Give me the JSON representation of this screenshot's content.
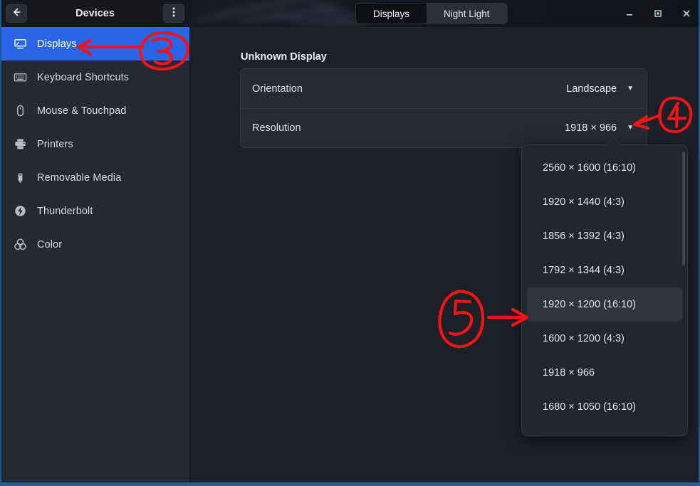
{
  "window": {
    "title": "Devices",
    "back_icon": "arrow-left-icon",
    "menu_icon": "kebab-menu-icon",
    "controls": {
      "minimize": "−",
      "maximize": "▫",
      "close": "✕"
    }
  },
  "tabs": [
    {
      "label": "Displays",
      "active": true
    },
    {
      "label": "Night Light",
      "active": false
    }
  ],
  "sidebar": {
    "items": [
      {
        "label": "Displays",
        "icon": "monitor-icon",
        "selected": true
      },
      {
        "label": "Keyboard Shortcuts",
        "icon": "keyboard-icon",
        "selected": false
      },
      {
        "label": "Mouse & Touchpad",
        "icon": "mouse-icon",
        "selected": false
      },
      {
        "label": "Printers",
        "icon": "printer-icon",
        "selected": false
      },
      {
        "label": "Removable Media",
        "icon": "usb-drive-icon",
        "selected": false
      },
      {
        "label": "Thunderbolt",
        "icon": "thunderbolt-icon",
        "selected": false
      },
      {
        "label": "Color",
        "icon": "color-circles-icon",
        "selected": false
      }
    ]
  },
  "main": {
    "display_title": "Unknown Display",
    "rows": [
      {
        "label": "Orientation",
        "value": "Landscape",
        "caret": "▼"
      },
      {
        "label": "Resolution",
        "value": "1918 × 966",
        "caret": "▼"
      }
    ]
  },
  "resolution_dropdown": {
    "open": true,
    "items": [
      {
        "label": "2560 × 1600 (16:10)",
        "highlighted": false
      },
      {
        "label": "1920 × 1440 (4:3)",
        "highlighted": false
      },
      {
        "label": "1856 × 1392 (4:3)",
        "highlighted": false
      },
      {
        "label": "1792 × 1344 (4:3)",
        "highlighted": false
      },
      {
        "label": "1920 × 1200 (16:10)",
        "highlighted": true
      },
      {
        "label": "1600 × 1200 (4:3)",
        "highlighted": false
      },
      {
        "label": "1918 × 966",
        "highlighted": false
      },
      {
        "label": "1680 × 1050 (16:10)",
        "highlighted": false
      }
    ]
  },
  "annotations": {
    "color": "#f21414",
    "marks": [
      {
        "id": "3",
        "text": "3",
        "target": "sidebar-item-displays"
      },
      {
        "id": "4",
        "text": "4",
        "target": "resolution-row-caret"
      },
      {
        "id": "5",
        "text": "5",
        "target": "dropdown-item-1920x1200"
      }
    ]
  },
  "theme": {
    "accent": "#2a65e8",
    "sidebar_bg": "#252932",
    "content_bg": "#1d2027",
    "titlebar_bg": "#15171d",
    "card_bg": "#262a33",
    "popup_bg": "#23262e",
    "focus_border": "#1f6198"
  }
}
